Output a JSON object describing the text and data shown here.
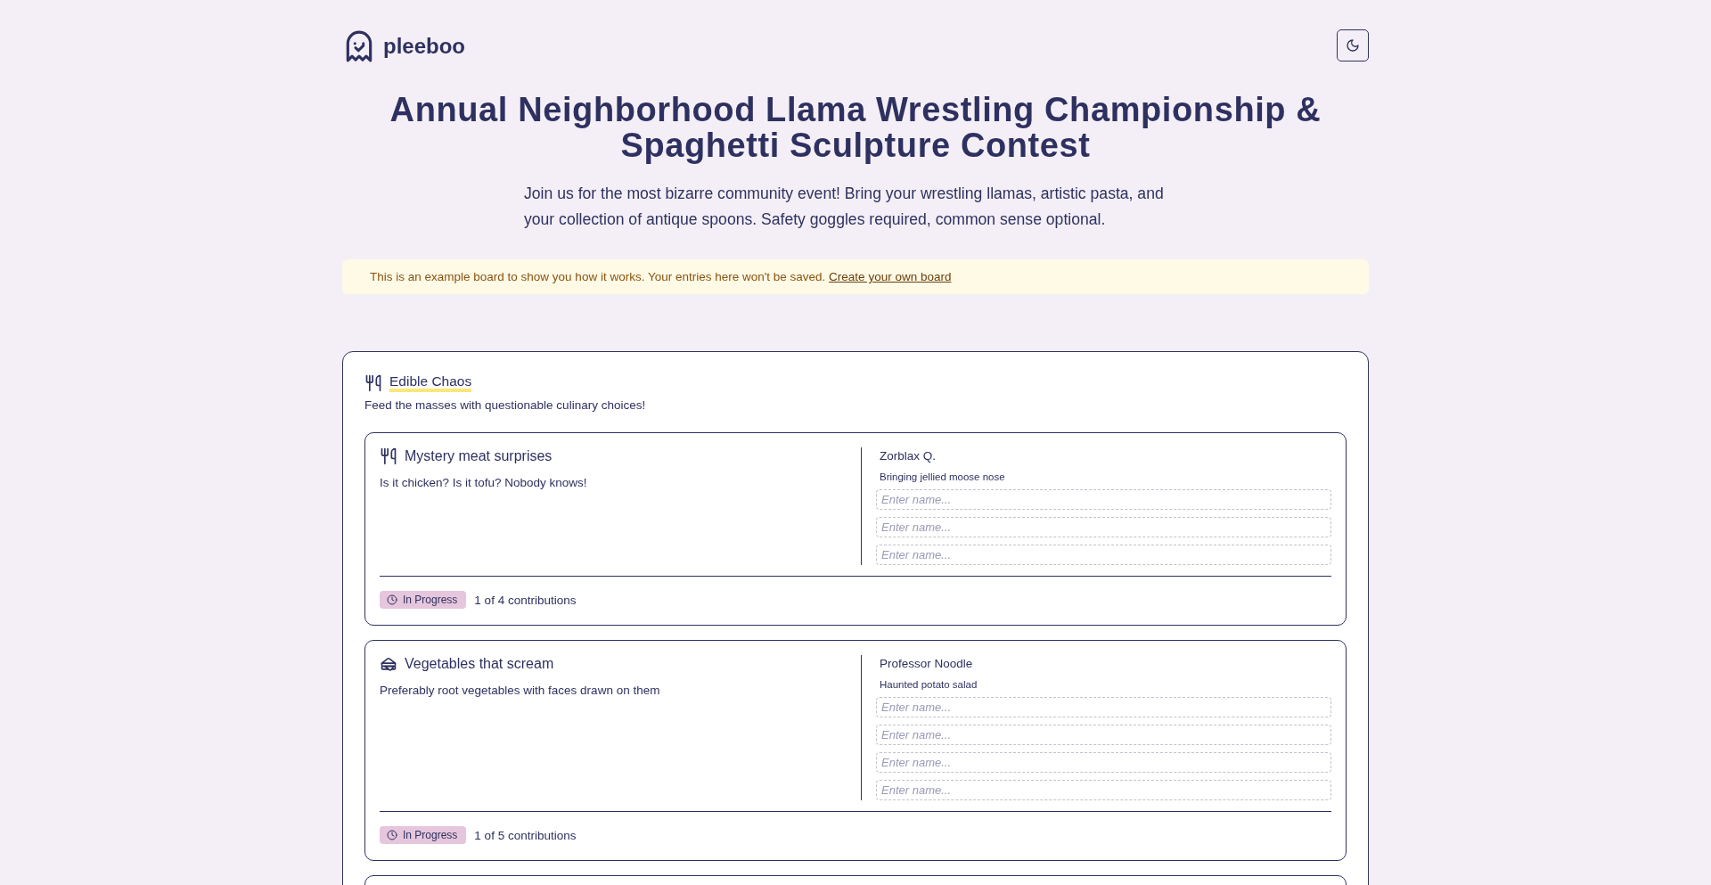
{
  "header": {
    "logo": "pleeboo",
    "theme_toggle": {
      "dark": false
    }
  },
  "event": {
    "title": "Annual Neighborhood Llama Wrestling Championship & Spaghetti Sculpture Contest",
    "description": "Join us for the most bizarre community event! Bring your wrestling llamas, artistic pasta, and your collection of antique spoons. Safety goggles required, common sense optional."
  },
  "notice": {
    "text": "This is an example board to show you how it works. Your entries here won't be saved.",
    "link": "Create your own board"
  },
  "sections": [
    {
      "title": "Edible Chaos",
      "kind": "utensils",
      "description": "Feed the masses with questionable culinary choices!",
      "tasks": [
        {
          "title": "Mystery meat surprises",
          "kind": "utensils",
          "description": "Is it chicken? Is it tofu? Nobody knows!",
          "contributions": [
            {
              "name": "Zorblax Q.",
              "note": "Bringing jellied moose nose"
            }
          ],
          "empty_slots": [
            {
              "placeholder": "Enter name..."
            },
            {
              "placeholder": "Enter name..."
            },
            {
              "placeholder": "Enter name..."
            }
          ],
          "status": "In Progress",
          "progress": "1 of 4 contributions"
        },
        {
          "title": "Vegetables that scream",
          "kind": "sandwich",
          "description": "Preferably root vegetables with faces drawn on them",
          "contributions": [
            {
              "name": "Professor Noodle",
              "note": "Haunted potato salad"
            }
          ],
          "empty_slots": [
            {
              "placeholder": "Enter name..."
            },
            {
              "placeholder": "Enter name..."
            },
            {
              "placeholder": "Enter name..."
            },
            {
              "placeholder": "Enter name..."
            }
          ],
          "status": "In Progress",
          "progress": "1 of 5 contributions"
        }
      ]
    }
  ]
}
